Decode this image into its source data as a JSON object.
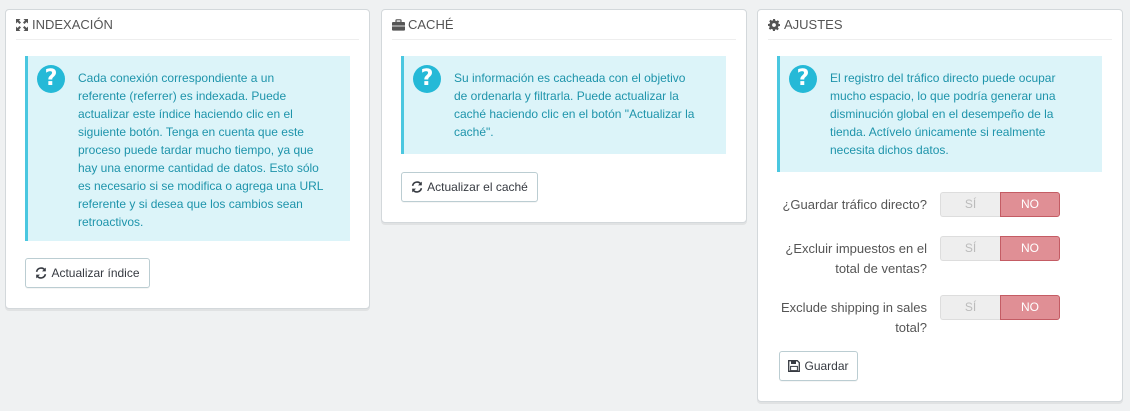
{
  "indexacion": {
    "title": "INDEXACIÓN",
    "alert_lines": [
      "Cada conexión correspondiente a un",
      "referente (referrer) es indexada. Puede",
      "actualizar este índice haciendo clic en el",
      "siguiente botón. Tenga en cuenta que este",
      "proceso puede tardar mucho tiempo, ya que",
      "hay una enorme cantidad de datos. Esto sólo",
      "es necesario si se modifica o agrega una URL",
      "referente y si desea que los cambios sean",
      "retroactivos."
    ],
    "button_label": "Actualizar índice"
  },
  "cache": {
    "title": "CACHÉ",
    "alert_lines": [
      "Su información es cacheada con el objetivo",
      "de ordenarla y filtrarla. Puede actualizar la",
      "caché haciendo clic en el botón \"Actualizar la",
      "caché\"."
    ],
    "button_label": "Actualizar el caché"
  },
  "ajustes": {
    "title": "AJUSTES",
    "alert_lines": [
      "El registro del tráfico directo puede ocupar",
      "mucho espacio, lo que podría generar una",
      "disminución global en el desempeño de la",
      "tienda. Actívelo únicamente si realmente",
      "necesita dichos datos."
    ],
    "fields": [
      {
        "label_lines": [
          "¿Guardar tráfico directo?"
        ],
        "yes": "SÍ",
        "no": "NO",
        "value": "NO"
      },
      {
        "label_lines": [
          "¿Excluir impuestos en el",
          "total de ventas?"
        ],
        "yes": "SÍ",
        "no": "NO",
        "value": "NO"
      },
      {
        "label_lines": [
          "Exclude shipping in sales",
          "total?"
        ],
        "yes": "SÍ",
        "no": "NO",
        "value": "NO"
      }
    ],
    "save_label": "Guardar"
  },
  "colors": {
    "alert_bg": "#dcf4f9",
    "alert_text": "#1e94ab",
    "alert_icon": "#25b9d7",
    "toggle_no_active": "#e08f95"
  },
  "icons": {
    "indexacion": "expand-arrows-icon",
    "cache": "briefcase-icon",
    "ajustes": "gear-icon",
    "help": "question-circle-icon",
    "refresh": "refresh-icon",
    "save": "floppy-disk-icon"
  }
}
